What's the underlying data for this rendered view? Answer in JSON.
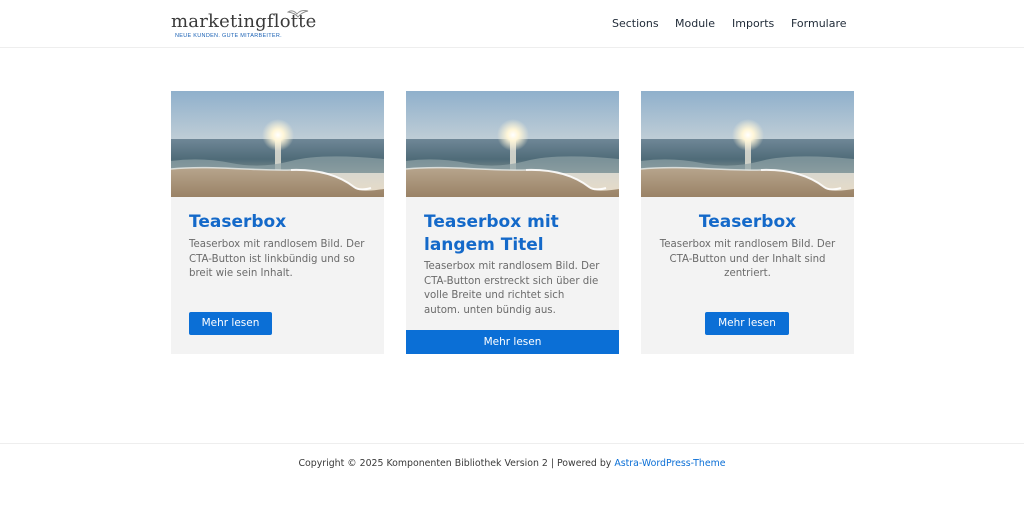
{
  "header": {
    "logo": {
      "name": "marketingflotte",
      "tagline": "NEUE KUNDEN. GUTE MITARBEITER."
    },
    "nav": [
      {
        "label": "Sections"
      },
      {
        "label": "Module"
      },
      {
        "label": "Imports"
      },
      {
        "label": "Formulare"
      }
    ]
  },
  "cards": [
    {
      "title": "Teaserbox",
      "text": "Teaserbox mit randlosem Bild. Der CTA-Button ist linkbündig und so breit wie sein Inhalt.",
      "button": "Mehr lesen",
      "image_icon": "beach-sunset-image"
    },
    {
      "title": "Teaserbox mit langem Titel",
      "text": "Teaserbox mit randlosem Bild. Der CTA-Button erstreckt sich über die volle Breite und richtet sich autom. unten bündig aus.",
      "button": "Mehr lesen",
      "image_icon": "beach-sunset-image"
    },
    {
      "title": "Teaserbox",
      "text": "Teaserbox mit randlosem Bild. Der CTA-Button und der Inhalt sind zentriert.",
      "button": "Mehr lesen",
      "image_icon": "beach-sunset-image"
    }
  ],
  "footer": {
    "copyright": "Copyright © 2025 Komponenten Bibliothek Version 2 | Powered by ",
    "link": "Astra-WordPress-Theme"
  },
  "colors": {
    "accent": "#0b6fd6",
    "title": "#1469c9",
    "card_bg": "#f3f3f3"
  }
}
